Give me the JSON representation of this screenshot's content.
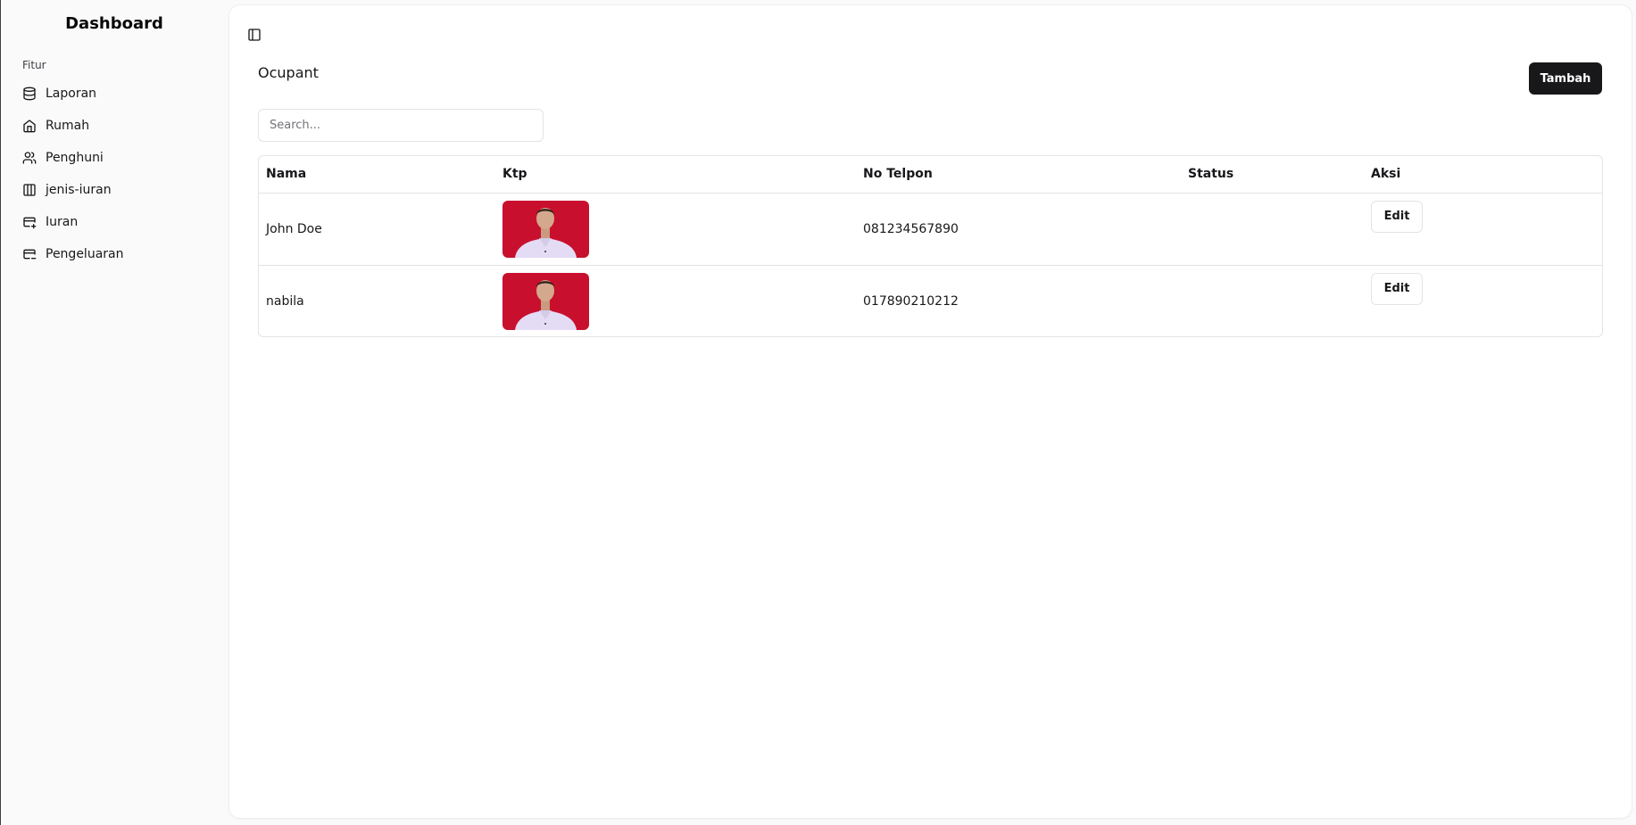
{
  "sidebar": {
    "title": "Dashboard",
    "group_label": "Fitur",
    "items": [
      {
        "label": "Laporan",
        "icon": "database-icon"
      },
      {
        "label": "Rumah",
        "icon": "home-icon"
      },
      {
        "label": "Penghuni",
        "icon": "users-icon"
      },
      {
        "label": "jenis-iuran",
        "icon": "columns-icon"
      },
      {
        "label": "Iuran",
        "icon": "payment-in-icon"
      },
      {
        "label": "Pengeluaran",
        "icon": "payment-out-icon"
      }
    ]
  },
  "main": {
    "toggle_icon": "sidebar-toggle-icon",
    "page_title": "Ocupant",
    "add_button": "Tambah",
    "search": {
      "placeholder": "Search...",
      "value": ""
    },
    "table": {
      "columns": [
        "Nama",
        "Ktp",
        "No Telpon",
        "Status",
        "Aksi"
      ],
      "rows": [
        {
          "nama": "John Doe",
          "ktp": "ktp-photo",
          "no_telpon": "081234567890",
          "status": "",
          "aksi": "Edit"
        },
        {
          "nama": "nabila",
          "ktp": "ktp-photo",
          "no_telpon": "017890210212",
          "status": "",
          "aksi": "Edit"
        }
      ]
    }
  },
  "colors": {
    "primary": "#18181b",
    "border": "#e4e4e7",
    "photo_background": "#c8102e",
    "photo_shirt": "#e4dcf5"
  }
}
